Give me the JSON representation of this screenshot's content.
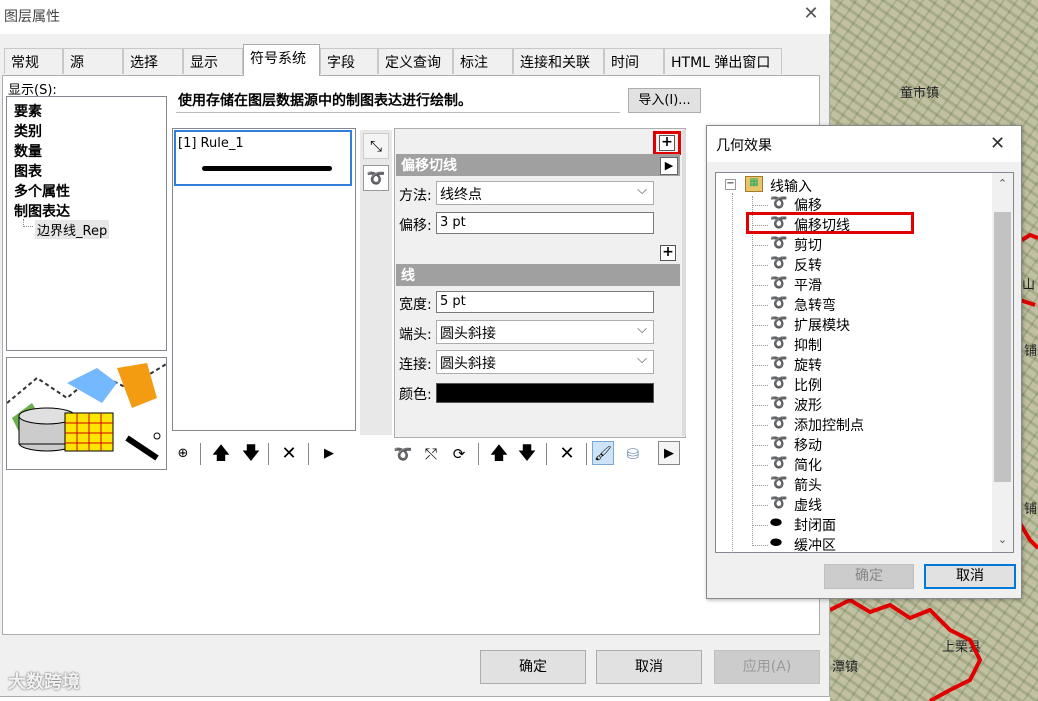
{
  "main_dialog": {
    "title": "图层属性",
    "tabs": [
      "常规",
      "源",
      "选择",
      "显示",
      "符号系统",
      "字段",
      "定义查询",
      "标注",
      "连接和关联",
      "时间",
      "HTML 弹出窗口"
    ],
    "active_tab": "符号系统"
  },
  "show_panel": {
    "label": "显示(S):",
    "items": [
      "要素",
      "类别",
      "数量",
      "图表",
      "多个属性",
      "制图表达"
    ],
    "sub_item": "边界线_Rep"
  },
  "description": "使用存储在图层数据源中的制图表达进行绘制。",
  "import_button": "导入(I)...",
  "rules": [
    {
      "label": "[1] Rule_1"
    }
  ],
  "properties": {
    "offset_group": {
      "title": "偏移切线",
      "method_label": "方法:",
      "method_value": "线终点",
      "offset_label": "偏移:",
      "offset_value": "3 pt"
    },
    "line_group": {
      "title": "线",
      "width_label": "宽度:",
      "width_value": "5 pt",
      "cap_label": "端头:",
      "cap_value": "圆头斜接",
      "join_label": "连接:",
      "join_value": "圆头斜接",
      "color_label": "颜色:",
      "color_value": "#000000"
    }
  },
  "buttons": {
    "ok": "确定",
    "cancel": "取消",
    "apply": "应用(A)"
  },
  "watermark": "大数跨境",
  "map": {
    "towns": [
      "童市镇",
      "上栗县",
      "山",
      "铺",
      "铺",
      "潭镇"
    ]
  },
  "geo_dialog": {
    "title": "几何效果",
    "root": "线输入",
    "items": [
      "偏移",
      "偏移切线",
      "剪切",
      "反转",
      "平滑",
      "急转弯",
      "扩展模块",
      "抑制",
      "旋转",
      "比例",
      "波形",
      "添加控制点",
      "移动",
      "简化",
      "箭头",
      "虚线",
      "封闭面",
      "缓冲区"
    ],
    "ok": "确定",
    "cancel": "取消"
  },
  "highlight_color": "#e00000"
}
